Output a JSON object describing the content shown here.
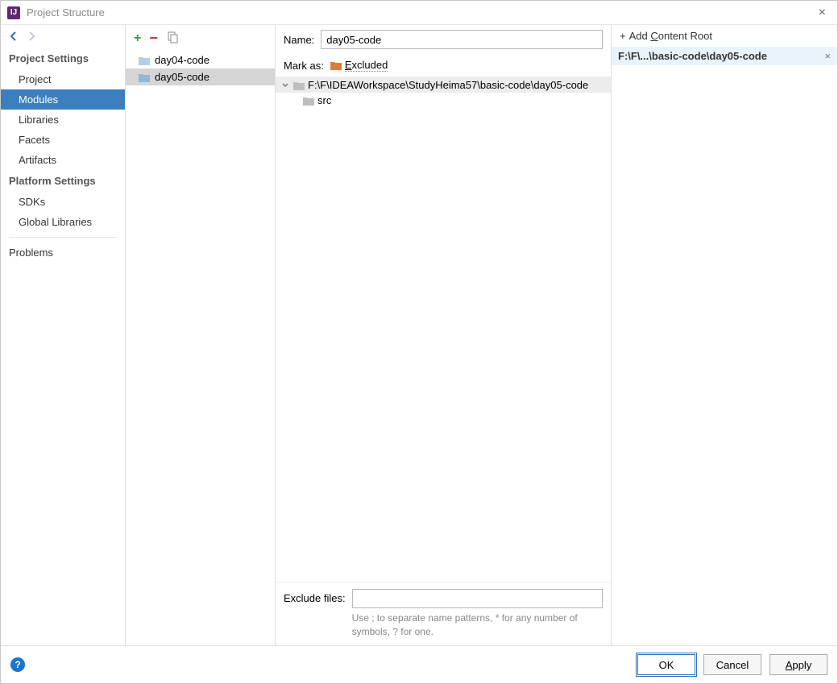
{
  "window": {
    "title": "Project Structure"
  },
  "sidebar": {
    "section1": "Project Settings",
    "items1": [
      "Project",
      "Modules",
      "Libraries",
      "Facets",
      "Artifacts"
    ],
    "section2": "Platform Settings",
    "items2": [
      "SDKs",
      "Global Libraries"
    ],
    "problems": "Problems"
  },
  "modules": {
    "list": [
      "day04-code",
      "day05-code"
    ],
    "selected": 1
  },
  "detail": {
    "nameLabel": "Name:",
    "nameValue": "day05-code",
    "markAsLabel": "Mark as:",
    "excludedLabel": "Excluded",
    "tree": {
      "rootPath": "F:\\F\\IDEAWorkspace\\StudyHeima57\\basic-code\\day05-code",
      "children": [
        "src"
      ]
    },
    "excludeLabel": "Exclude files:",
    "excludeHint": "Use ; to separate name patterns, * for any number of symbols, ? for one."
  },
  "contentRoot": {
    "addLabel": "Add Content Root",
    "path": "F:\\F\\...\\basic-code\\day05-code"
  },
  "footer": {
    "ok": "OK",
    "cancel": "Cancel",
    "apply": "Apply"
  }
}
